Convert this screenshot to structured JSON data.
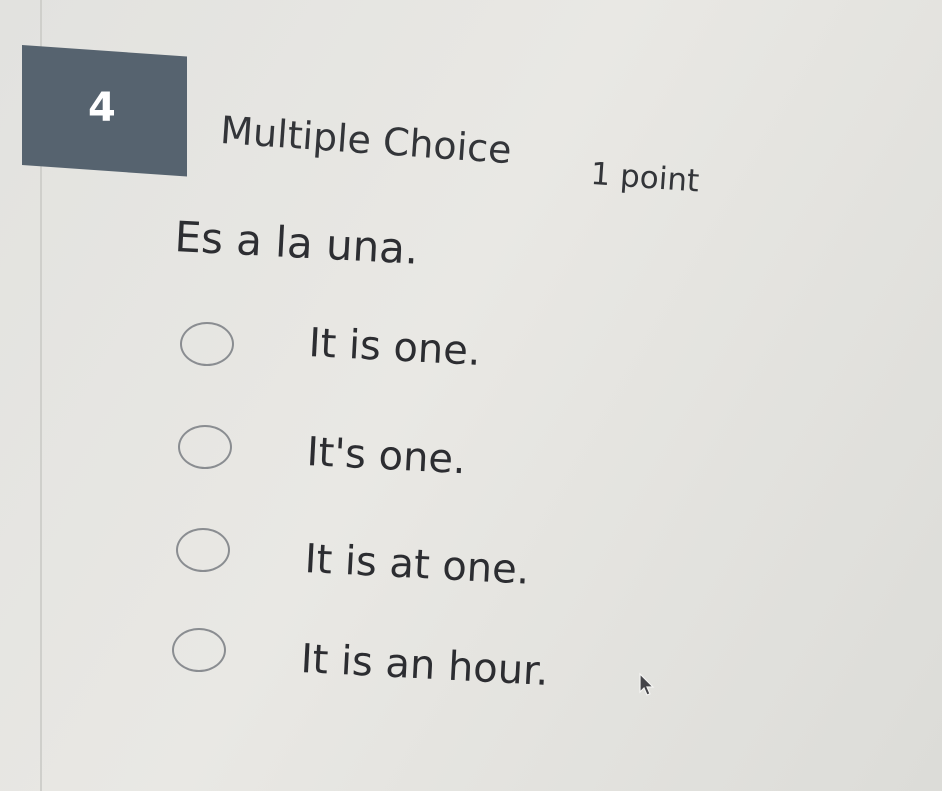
{
  "question": {
    "number": "4",
    "type": "Multiple Choice",
    "points": "1 point",
    "prompt": "Es a la una.",
    "options": [
      {
        "label": "It is one.",
        "selected": false
      },
      {
        "label": "It's one.",
        "selected": false
      },
      {
        "label": "It is at one.",
        "selected": false
      },
      {
        "label": "It is an hour.",
        "selected": false
      }
    ]
  },
  "colors": {
    "number_box": "#56636f",
    "background": "#e6e5e1",
    "text": "#2f3034",
    "radio_border": "#8a8d91"
  },
  "icons": {
    "cursor": "arrow-cursor-icon"
  }
}
